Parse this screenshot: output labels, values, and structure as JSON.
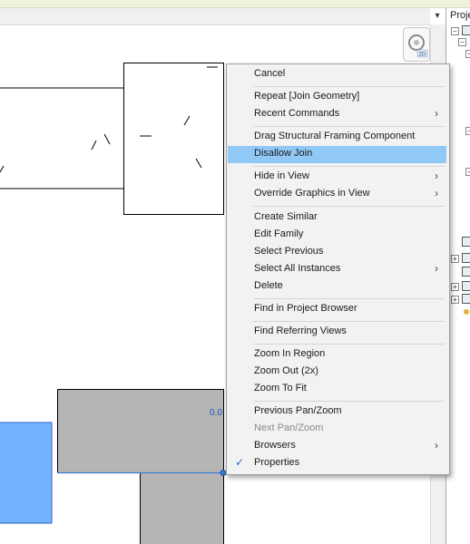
{
  "view": {
    "dimension_label": "0.0"
  },
  "project_browser": {
    "title": "Proje"
  },
  "context_menu": {
    "items": [
      {
        "label": "Cancel",
        "submenu": false,
        "state": "normal"
      },
      {
        "label": "Repeat [Join Geometry]",
        "submenu": false,
        "state": "normal"
      },
      {
        "label": "Recent Commands",
        "submenu": true,
        "state": "normal"
      },
      {
        "label": "Drag Structural Framing Component",
        "submenu": false,
        "state": "normal"
      },
      {
        "label": "Disallow Join",
        "submenu": false,
        "state": "highlighted"
      },
      {
        "label": "Hide in View",
        "submenu": true,
        "state": "normal"
      },
      {
        "label": "Override Graphics in View",
        "submenu": true,
        "state": "normal"
      },
      {
        "label": "Create Similar",
        "submenu": false,
        "state": "normal"
      },
      {
        "label": "Edit Family",
        "submenu": false,
        "state": "normal"
      },
      {
        "label": "Select Previous",
        "submenu": false,
        "state": "normal"
      },
      {
        "label": "Select All Instances",
        "submenu": true,
        "state": "normal"
      },
      {
        "label": "Delete",
        "submenu": false,
        "state": "normal"
      },
      {
        "label": "Find in Project Browser",
        "submenu": false,
        "state": "normal"
      },
      {
        "label": "Find Referring Views",
        "submenu": false,
        "state": "normal"
      },
      {
        "label": "Zoom In Region",
        "submenu": false,
        "state": "normal"
      },
      {
        "label": "Zoom Out (2x)",
        "submenu": false,
        "state": "normal"
      },
      {
        "label": "Zoom To Fit",
        "submenu": false,
        "state": "normal"
      },
      {
        "label": "Previous Pan/Zoom",
        "submenu": false,
        "state": "normal"
      },
      {
        "label": "Next Pan/Zoom",
        "submenu": false,
        "state": "disabled"
      },
      {
        "label": "Browsers",
        "submenu": true,
        "state": "normal"
      },
      {
        "label": "Properties",
        "submenu": false,
        "state": "checked"
      }
    ]
  },
  "colors": {
    "highlight": "#90c8f6",
    "selected_element": "#72b2ff",
    "element_fill": "#b5b5b5",
    "dimension_text": "#2050c0"
  },
  "icons": {
    "submenu_arrow": "chevron-right-icon",
    "check": "check-icon"
  }
}
